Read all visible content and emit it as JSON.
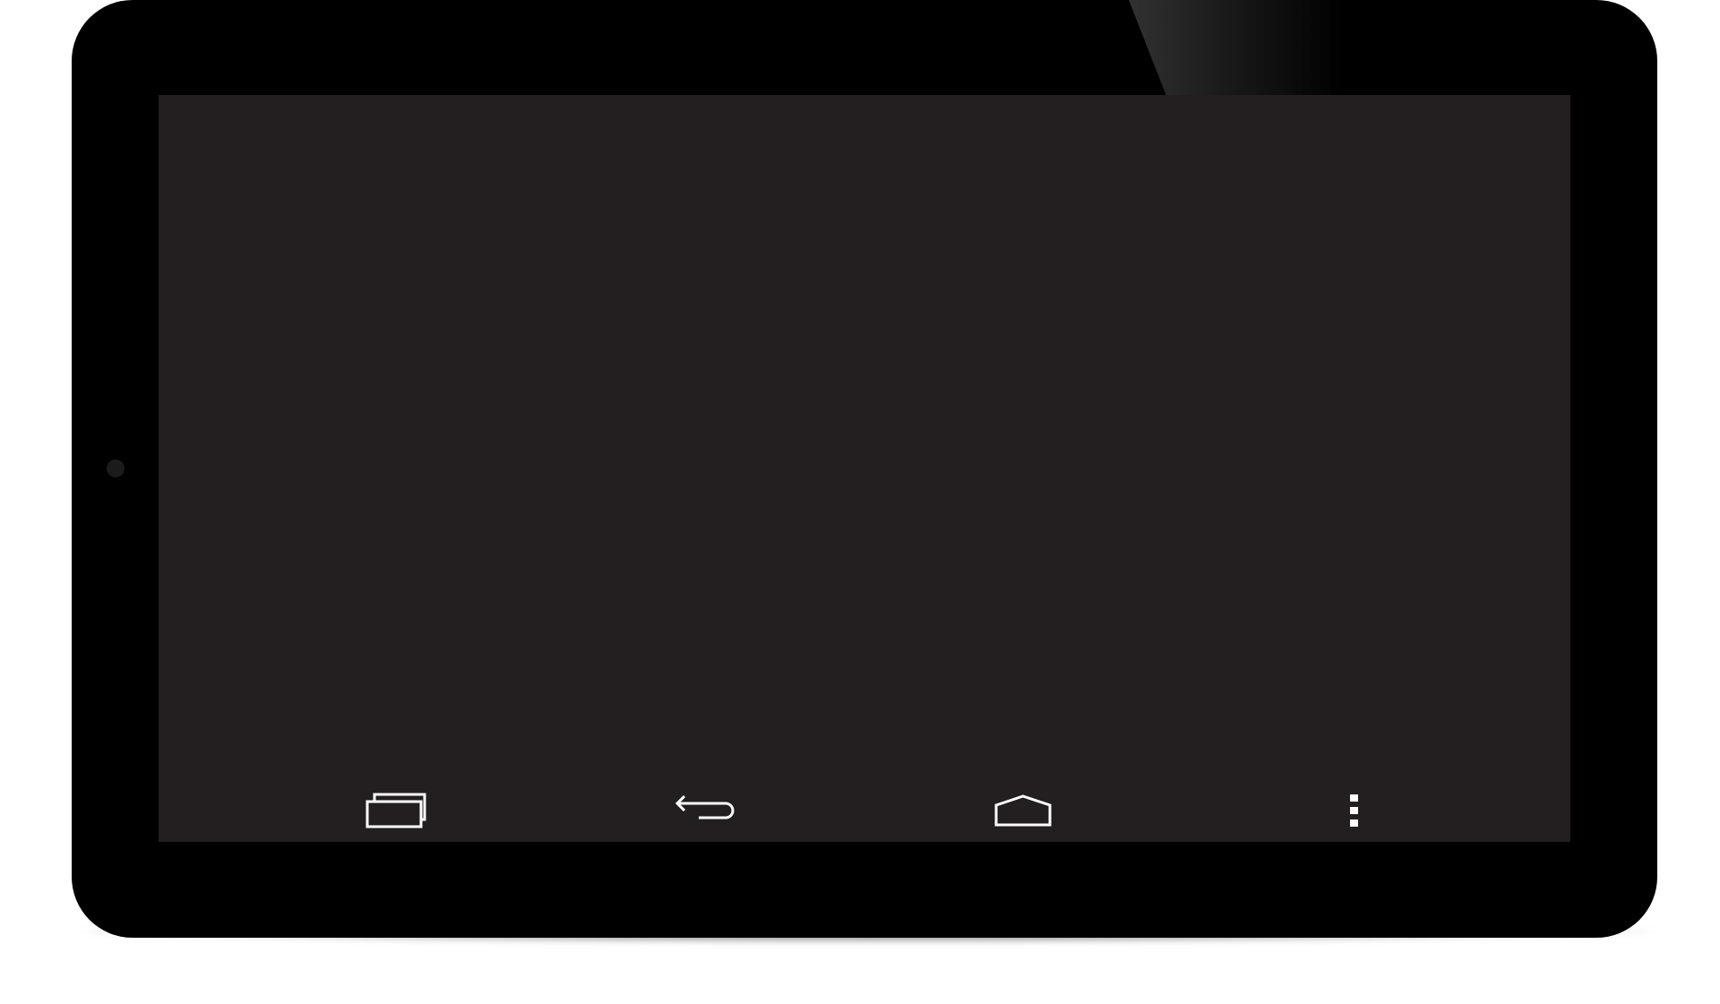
{
  "device": {
    "frame_color": "#000000",
    "screen_color": "#231f20",
    "icon_color": "#ffffff"
  },
  "navbar": {
    "buttons": [
      {
        "id": "recent-apps",
        "icon": "recent-apps-icon",
        "label": ""
      },
      {
        "id": "back",
        "icon": "back-icon",
        "label": ""
      },
      {
        "id": "home",
        "icon": "home-icon",
        "label": ""
      },
      {
        "id": "menu",
        "icon": "overflow-menu-icon",
        "label": ""
      }
    ]
  }
}
